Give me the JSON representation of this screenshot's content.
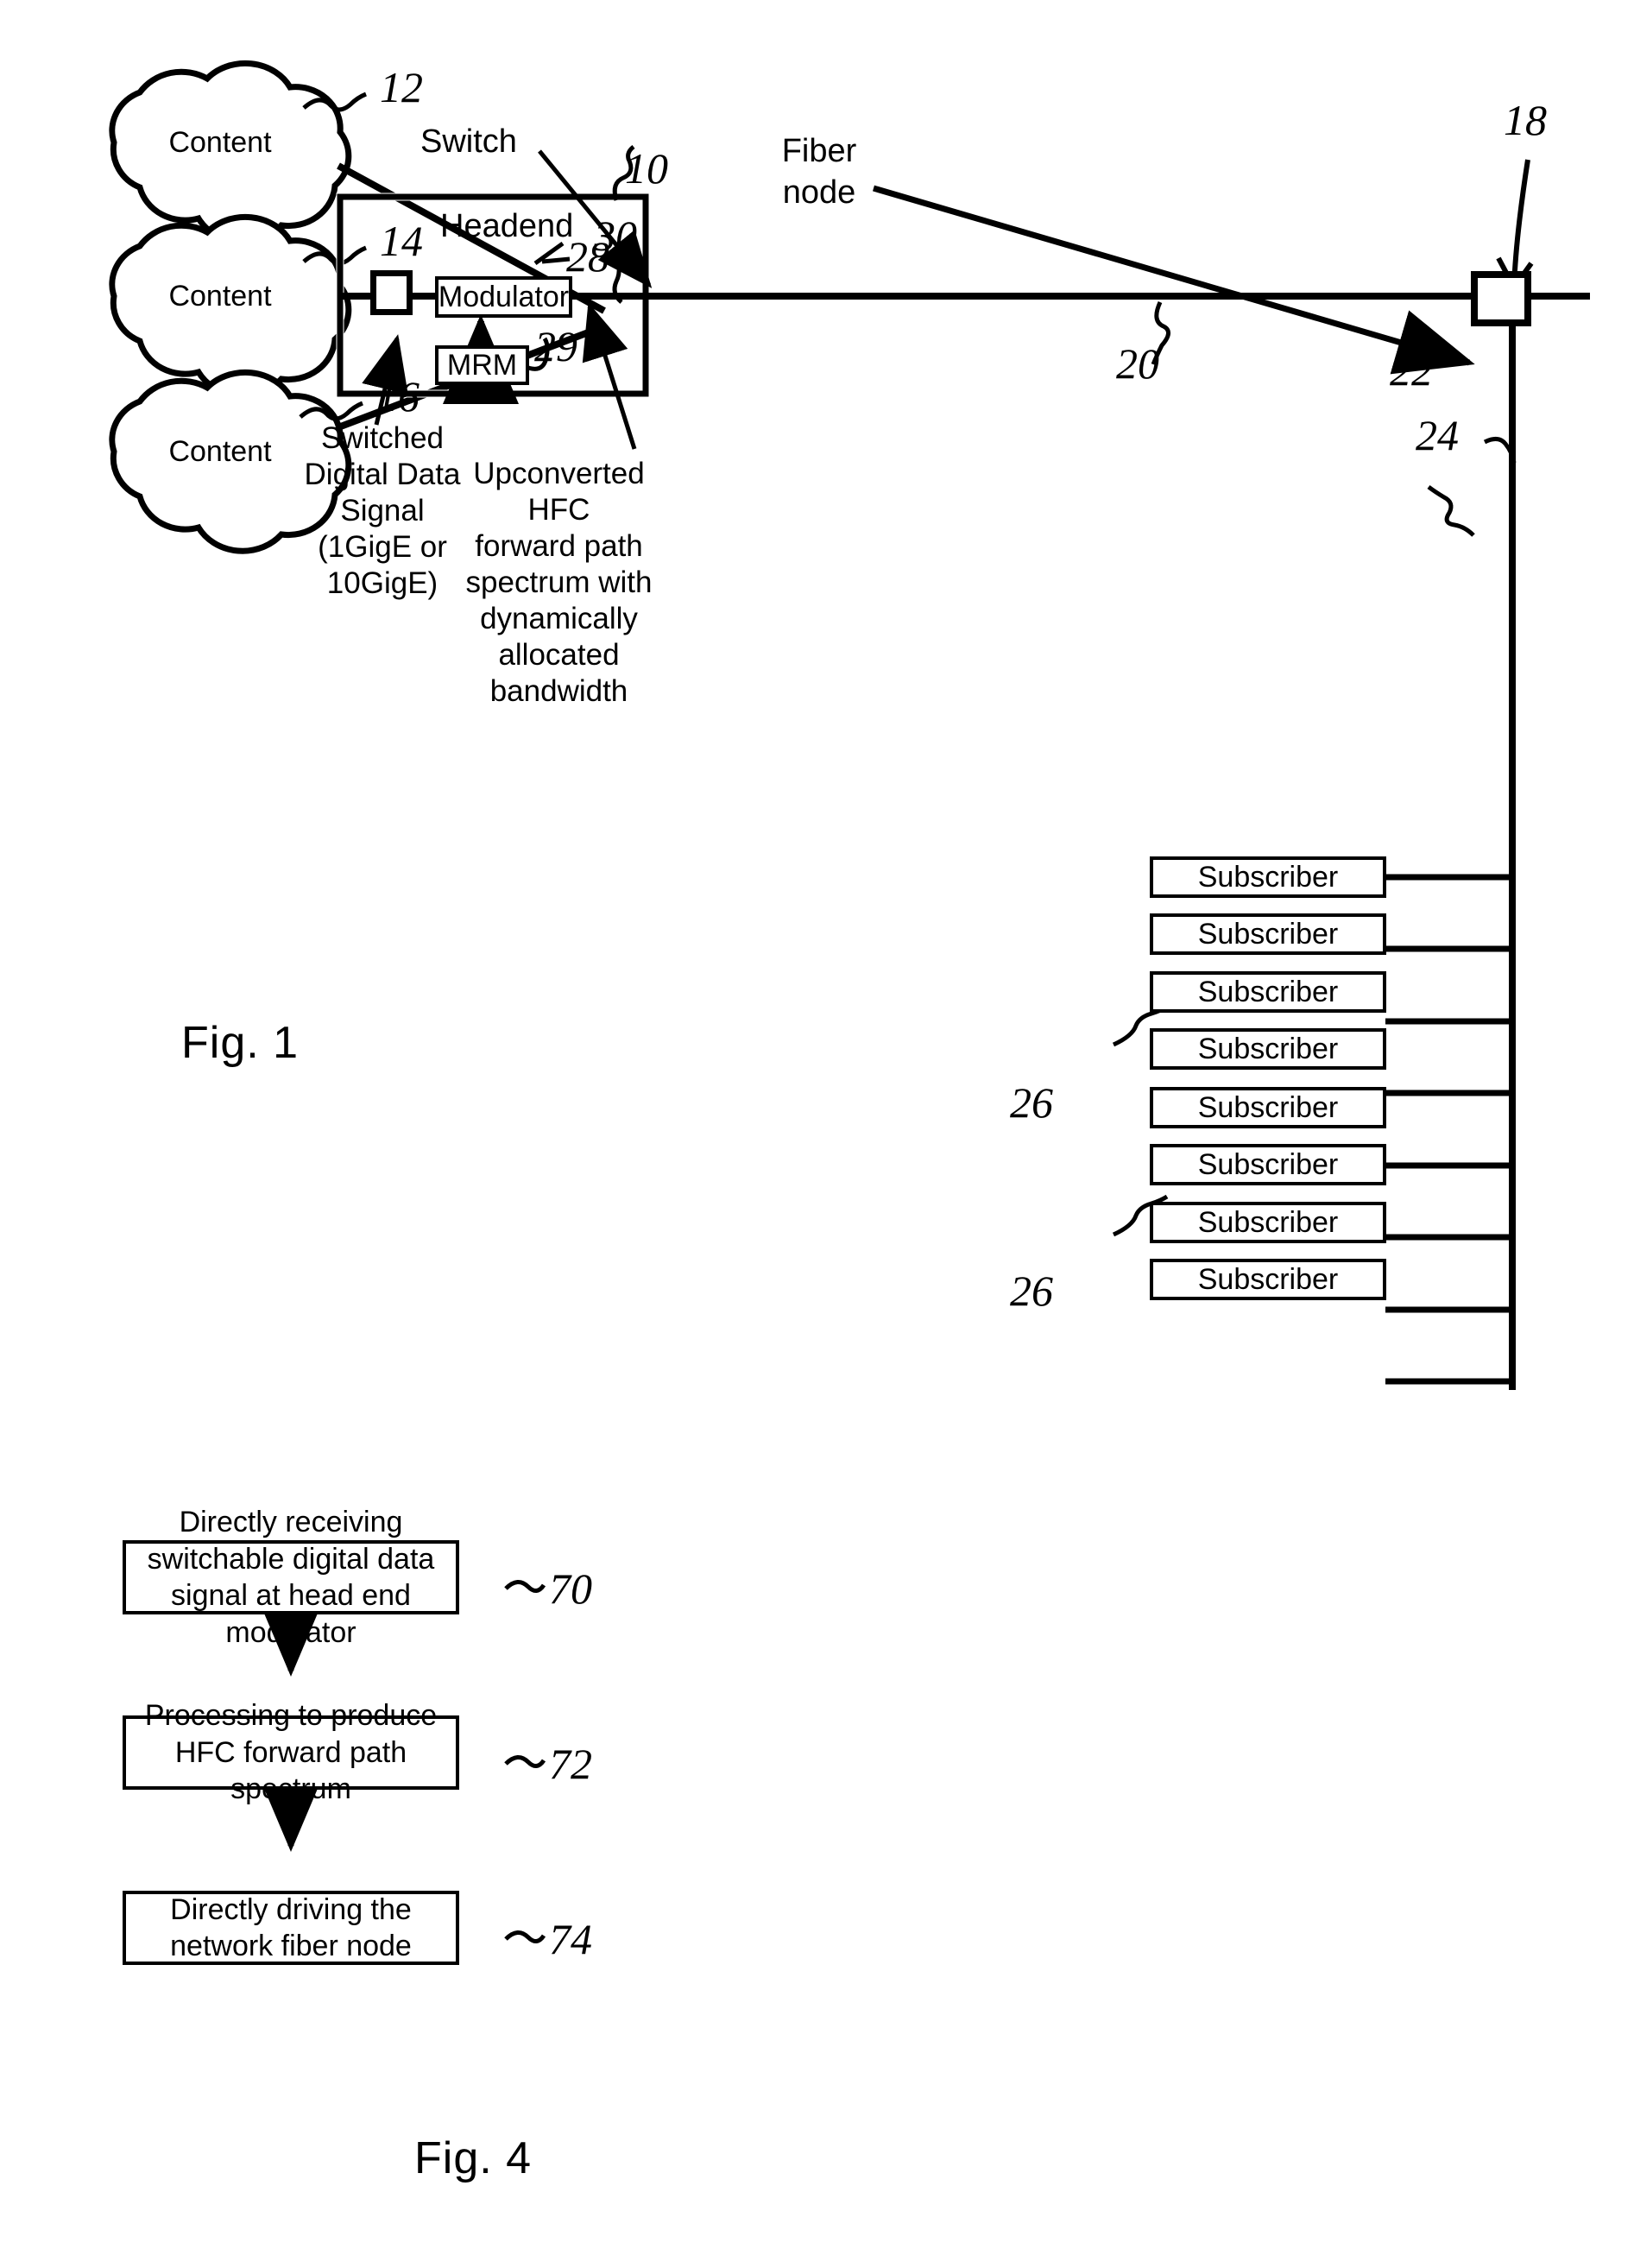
{
  "figure1": {
    "fig_label": "Fig. 1",
    "clouds": [
      {
        "label": "Content",
        "ref": "12"
      },
      {
        "label": "Content",
        "ref": "14"
      },
      {
        "label": "Content",
        "ref": "16"
      }
    ],
    "headend": {
      "title": "Headend",
      "ref": "10",
      "switch_ref": "30",
      "switch_callout": "Switch",
      "modulator": {
        "label": "Modulator",
        "ref": "28"
      },
      "mrm": {
        "label": "MRM",
        "ref": "29"
      }
    },
    "trunk_ref": "20",
    "fiber_node": {
      "callout": "Fiber\nnode",
      "ref": "22"
    },
    "system_ref": "18",
    "distribution_ref": "24",
    "subscriber_ref_upper": "26",
    "subscriber_ref_lower": "26",
    "subscribers": [
      "Subscriber",
      "Subscriber",
      "Subscriber",
      "Subscriber",
      "Subscriber",
      "Subscriber",
      "Subscriber",
      "Subscriber"
    ],
    "annotation_left": "Switched\nDigital Data\nSignal\n(1GigE or\n10GigE)",
    "annotation_right": "Upconverted HFC\nforward path\nspectrum with\ndynamically allocated\nbandwidth"
  },
  "figure4": {
    "fig_label": "Fig. 4",
    "steps": [
      {
        "text": "Directly receiving switchable digital data signal at head end modulator",
        "ref": "70"
      },
      {
        "text": "Processing to produce HFC forward path spectrum",
        "ref": "72"
      },
      {
        "text": "Directly driving the network fiber node",
        "ref": "74"
      }
    ]
  },
  "colors": {
    "ink": "#000000",
    "paper": "#ffffff"
  }
}
